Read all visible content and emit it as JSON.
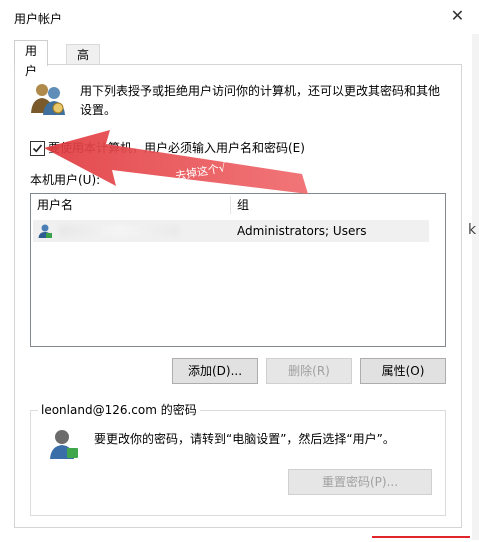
{
  "window": {
    "title": "用户帐户",
    "close_glyph": "✕"
  },
  "tabs": [
    {
      "label": "用户"
    },
    {
      "label": "高级"
    }
  ],
  "intro_text": "用下列表授予或拒绝用户访问你的计算机，还可以更改其密码和其他设置。",
  "checkbox": {
    "label": "要使用本计算机，用户必须输入用户名和密码(E)",
    "checked": true
  },
  "users_list": {
    "label": "本机用户(U):",
    "columns": [
      "用户名",
      "组"
    ],
    "rows": [
      {
        "name": "",
        "group": "Administrators; Users"
      }
    ]
  },
  "buttons": {
    "add": "添加(D)...",
    "remove": "删除(R)",
    "properties": "属性(O)",
    "reset_password": "重置密码(P)..."
  },
  "password_section": {
    "title": "leonland@126.com 的密码",
    "text": "要更改你的密码，请转到“电脑设置”，然后选择“用户”。"
  },
  "annotation": {
    "text": "去掉这个√",
    "color": "#e8474b"
  },
  "icons": {
    "users": "users-group-icon",
    "user_row": "user-icon",
    "password_user": "user-key-icon",
    "checkmark": "checkmark-icon",
    "arrow": "red-arrow-icon"
  }
}
